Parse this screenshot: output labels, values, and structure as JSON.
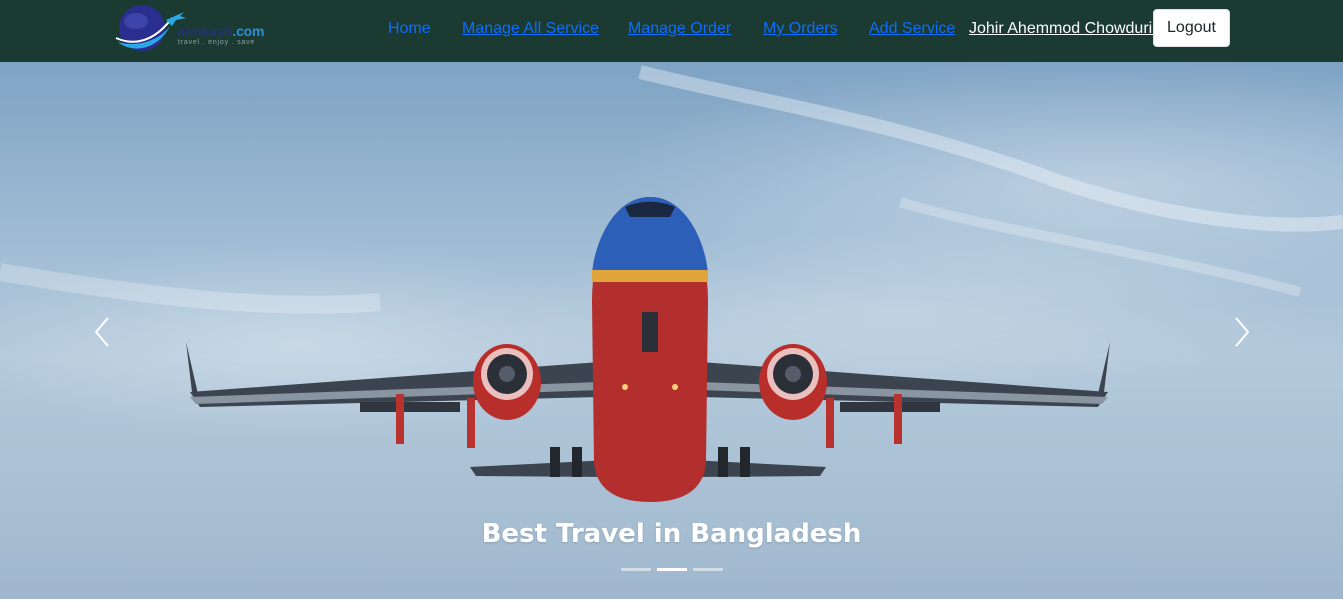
{
  "brand": {
    "name_prefix": "abokash",
    "name_suffix": ".com",
    "tagline": "travel . enjoy . save"
  },
  "nav": {
    "links": [
      {
        "label": "Home",
        "underlined": false
      },
      {
        "label": "Manage All Service",
        "underlined": true
      },
      {
        "label": "Manage Order",
        "underlined": true
      },
      {
        "label": "My Orders",
        "underlined": true
      },
      {
        "label": "Add Service",
        "underlined": true
      }
    ],
    "user_name": "Johir Ahemmod Chowdurie",
    "logout_label": "Logout"
  },
  "hero": {
    "caption": "Best Travel in Bangladesh",
    "slide_count": 3,
    "active_slide": 2,
    "prev_icon": "chevron-left-icon",
    "next_icon": "chevron-right-icon"
  },
  "colors": {
    "navbar_bg": "#1b3a32",
    "link": "#0d6efd",
    "user_link": "#ffffff"
  }
}
